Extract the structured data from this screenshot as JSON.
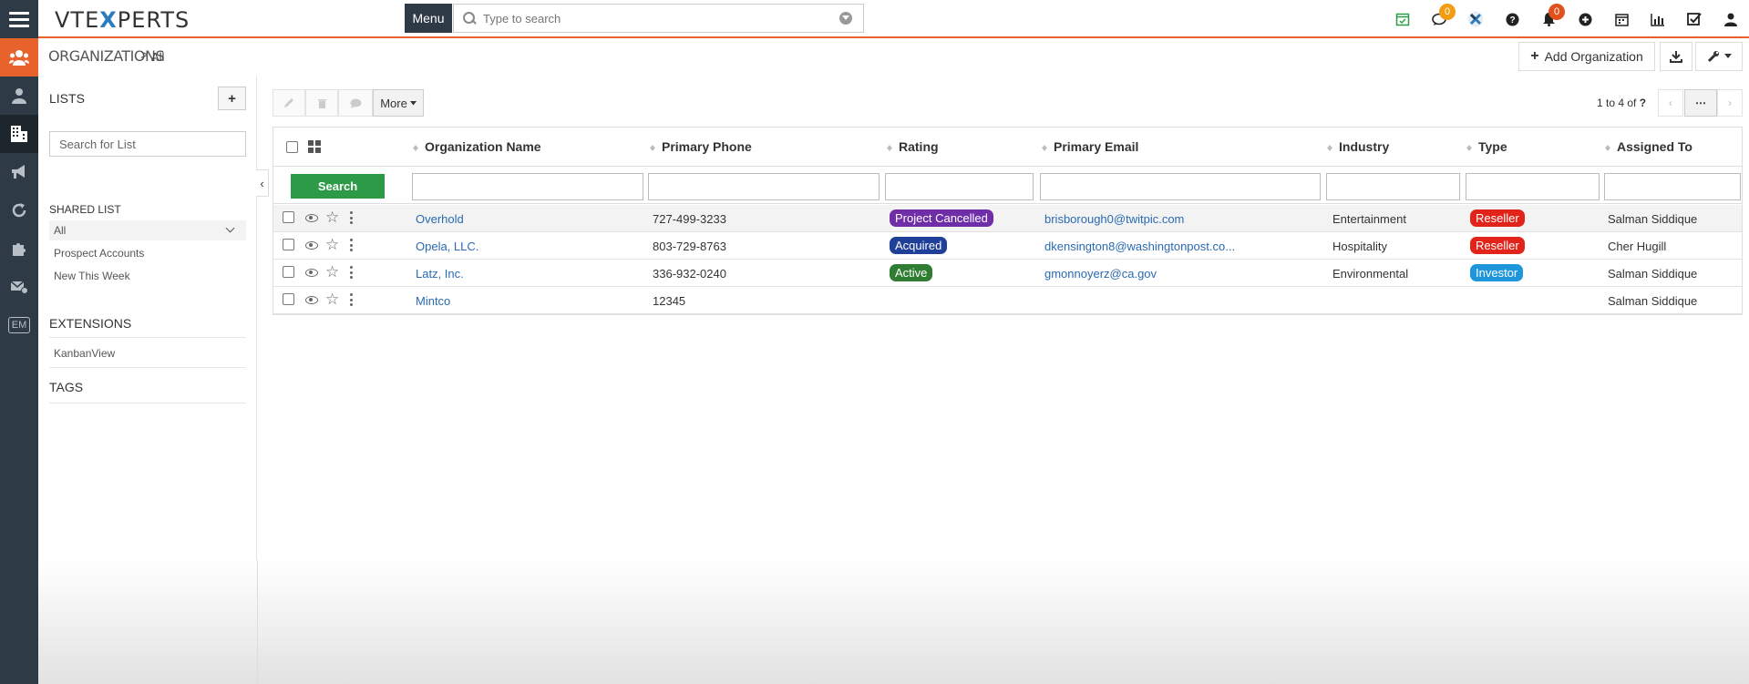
{
  "topbar": {
    "logo_left": "VTE",
    "logo_x": "X",
    "logo_right": "PERTS",
    "menu_label": "Menu",
    "search_placeholder": "Type to search",
    "chat_badge": "0",
    "notif_badge": "0"
  },
  "breadcrumb": {
    "module": "ORGANIZATIONS",
    "separator": ">",
    "view": "All"
  },
  "actions": {
    "add_label": "Add Organization"
  },
  "lists": {
    "title": "LISTS",
    "add_symbol": "+",
    "search_placeholder": "Search for List",
    "shared_title": "SHARED LIST",
    "shared_items": [
      "All",
      "Prospect Accounts",
      "New This Week"
    ],
    "extensions_title": "EXTENSIONS",
    "extensions_items": [
      "KanbanView"
    ],
    "tags_title": "TAGS"
  },
  "toolbar": {
    "more_label": "More",
    "pagination": "1 to 4  of ",
    "pagination_total": "?",
    "more_dots": "⋯"
  },
  "grid": {
    "search_label": "Search",
    "columns": [
      "Organization Name",
      "Primary Phone",
      "Rating",
      "Primary Email",
      "Industry",
      "Type",
      "Assigned To"
    ],
    "rows": [
      {
        "name": "Overhold",
        "phone": "727-499-3233",
        "rating": "Project Cancelled",
        "email": "brisborough0@twitpic.com",
        "industry": "Entertainment",
        "type": "Reseller",
        "assigned": "Salman Siddique"
      },
      {
        "name": "Opela, LLC.",
        "phone": "803-729-8763",
        "rating": "Acquired",
        "email": "dkensington8@washingtonpost.co...",
        "industry": "Hospitality",
        "type": "Reseller",
        "assigned": "Cher Hugill"
      },
      {
        "name": "Latz, Inc.",
        "phone": "336-932-0240",
        "rating": "Active",
        "email": "gmonnoyerz@ca.gov",
        "industry": "Environmental",
        "type": "Investor",
        "assigned": "Salman Siddique"
      },
      {
        "name": "Mintco",
        "phone": "12345",
        "rating": "",
        "email": "",
        "industry": "",
        "type": "",
        "assigned": "Salman Siddique"
      }
    ]
  },
  "colors": {
    "accent": "#e8632b",
    "rail": "#2e3a45",
    "rating_cancelled": "#6f2da8",
    "rating_acquired": "#1f3f99",
    "rating_active": "#2e7d32",
    "type_reseller": "#e2231a",
    "type_investor": "#1e96dc",
    "search_button": "#2d9a48"
  }
}
